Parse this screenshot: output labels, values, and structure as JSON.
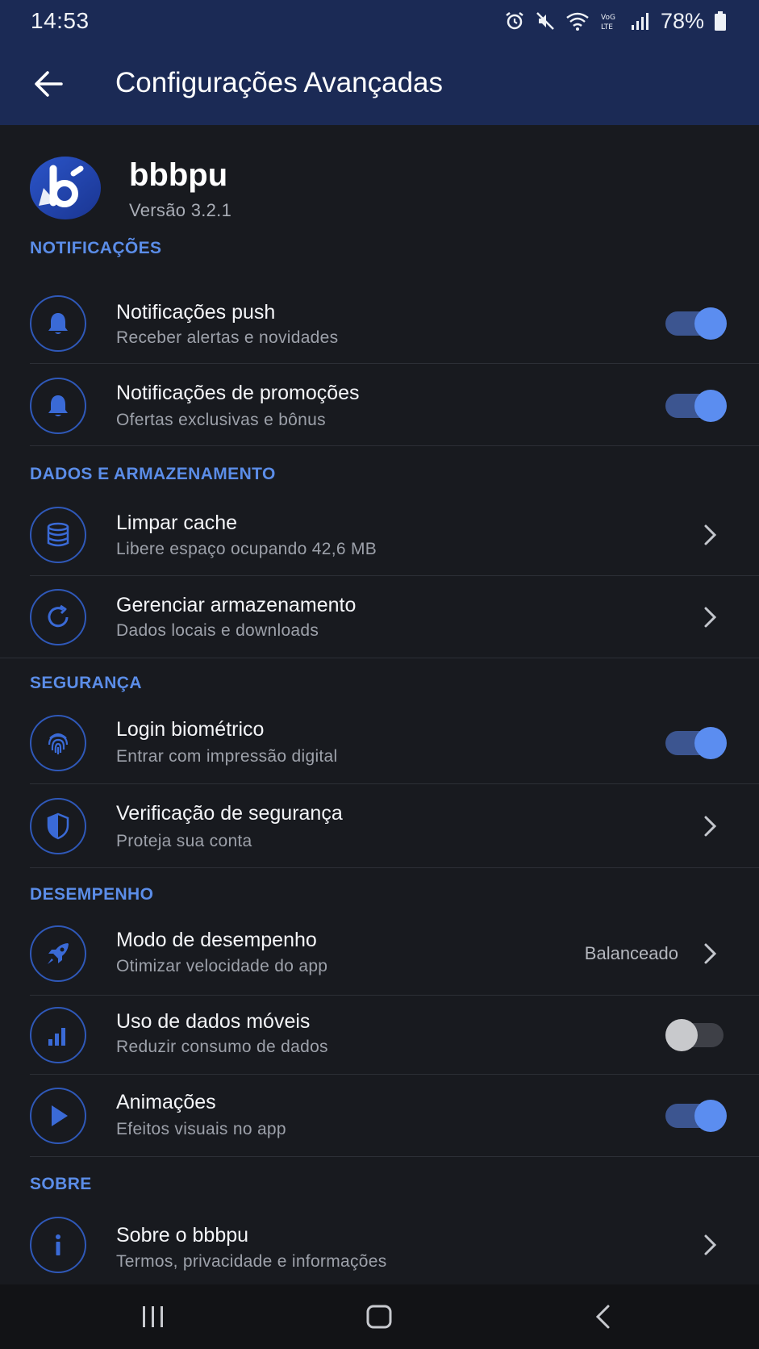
{
  "status_bar": {
    "time": "14:53",
    "network": "Vo LTE",
    "battery": "78%"
  },
  "app_bar": {
    "title": "Configurações Avançadas",
    "back_icon": "arrow-left-icon"
  },
  "app_info": {
    "name": "bbbpu",
    "version": "Versão 3.2.1"
  },
  "sections": {
    "notifications": {
      "header": "NOTIFICAÇÕES",
      "push": {
        "title": "Notificações push",
        "subtitle": "Receber alertas e novidades",
        "enabled": true,
        "icon": "bell-icon"
      },
      "promos": {
        "title": "Notificações de promoções",
        "subtitle": "Ofertas exclusivas e bônus",
        "enabled": true,
        "icon": "bell-icon"
      }
    },
    "storage": {
      "header": "DADOS E ARMAZENAMENTO",
      "cache": {
        "title": "Limpar cache",
        "subtitle": "Libere espaço ocupando 42,6 MB",
        "icon": "database-icon"
      },
      "manage": {
        "title": "Gerenciar armazenamento",
        "subtitle": "Dados locais e downloads",
        "icon": "refresh-icon"
      }
    },
    "security": {
      "header": "SEGURANÇA",
      "biometric": {
        "title": "Login biométrico",
        "subtitle": "Entrar com impressão digital",
        "enabled": true,
        "icon": "fingerprint-icon"
      },
      "verify": {
        "title": "Verificação de segurança",
        "subtitle": "Proteja sua conta",
        "icon": "shield-icon"
      }
    },
    "performance": {
      "header": "DESEMPENHO",
      "mode": {
        "title": "Modo de desempenho",
        "subtitle": "Otimizar velocidade do app",
        "value": "Balanceado",
        "icon": "rocket-icon"
      },
      "mobile_data": {
        "title": "Uso de dados móveis",
        "subtitle": "Reduzir consumo de dados",
        "enabled": false,
        "icon": "signal-bars-icon"
      },
      "animations": {
        "title": "Animações",
        "subtitle": "Efeitos visuais no app",
        "enabled": true,
        "icon": "play-icon"
      }
    },
    "about": {
      "header": "SOBRE",
      "about_app": {
        "title": "Sobre o bbbpu",
        "subtitle": "Termos, privacidade e informações",
        "icon": "info-icon"
      }
    }
  },
  "colors": {
    "app_bar": "#1b2a55",
    "background": "#181a1f",
    "accent": "#5b8de8",
    "toggle_on_knob": "#5b8df0",
    "toggle_on_track": "#3c5590"
  }
}
